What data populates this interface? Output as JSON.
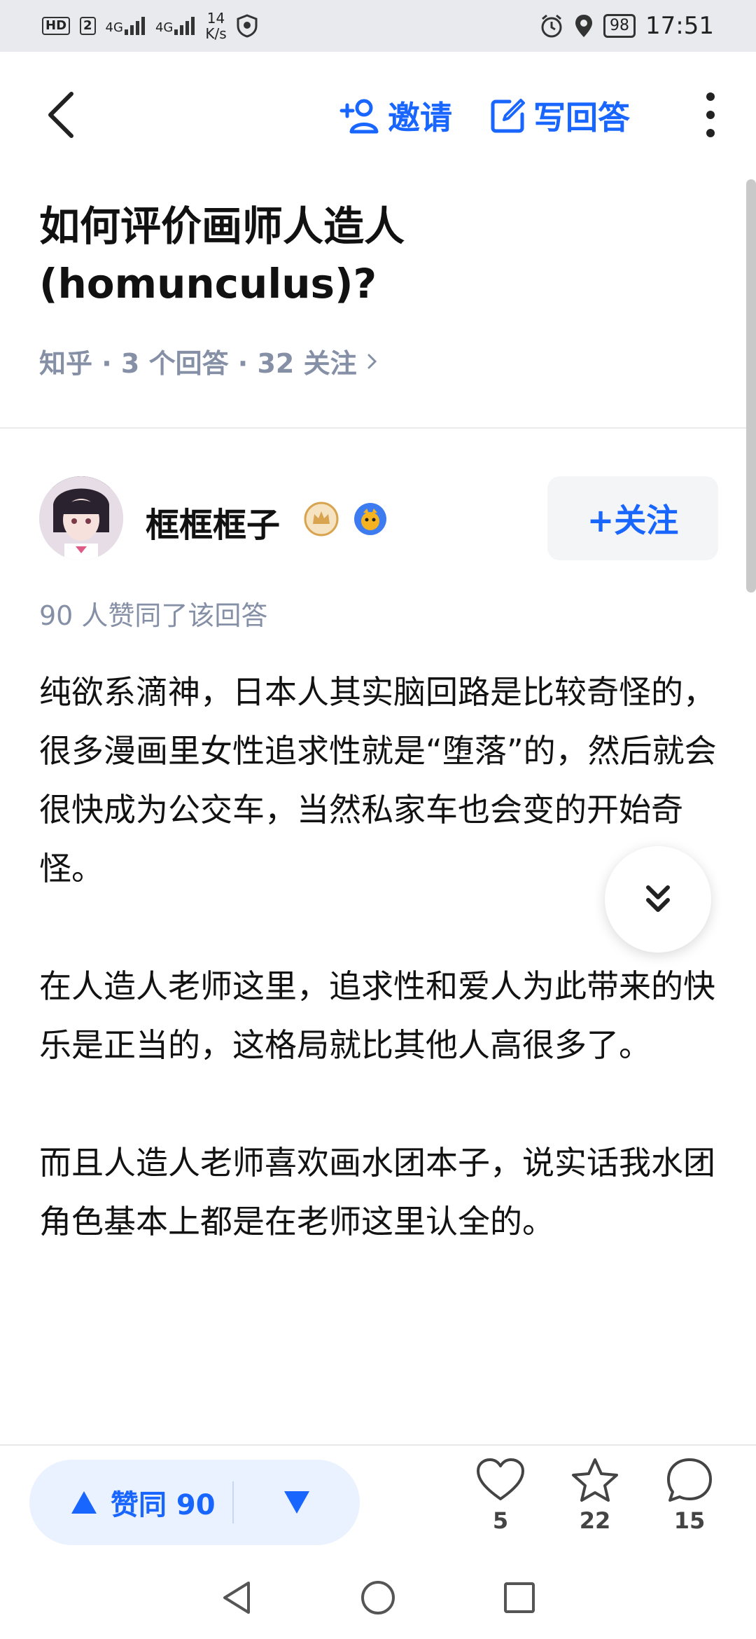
{
  "status_bar": {
    "hd_label": "HD",
    "sim_num": "2",
    "net1": "4G",
    "net2": "4G",
    "speed_value": "14",
    "speed_unit": "K/s",
    "battery": "98",
    "time": "17:51"
  },
  "nav": {
    "invite_label": "邀请",
    "write_label": "写回答"
  },
  "question": {
    "title": "如何评价画师人造人(homunculus)?",
    "meta": "知乎 · 3 个回答 · 32 关注"
  },
  "author": {
    "name": "框框框子",
    "follow_label": "+关注"
  },
  "answer": {
    "agree_text": "90 人赞同了该回答",
    "paragraphs": [
      "纯欲系滴神，日本人其实脑回路是比较奇怪的，很多漫画里女性追求性就是“堕落”的，然后就会很快成为公交车，当然私家车也会变的开始奇怪。",
      "在人造人老师这里，追求性和爱人为此带来的快乐是正当的，这格局就比其他人高很多了。",
      "而且人造人老师喜欢画水团本子，说实话我水团角色基本上都是在老师这里认全的。"
    ]
  },
  "actions": {
    "vote_label": "赞同 90",
    "likes": "5",
    "favorites": "22",
    "comments": "15"
  },
  "colors": {
    "accent": "#1966ff",
    "meta_gray": "#8590a6",
    "vote_bg": "#eaf1ff"
  }
}
